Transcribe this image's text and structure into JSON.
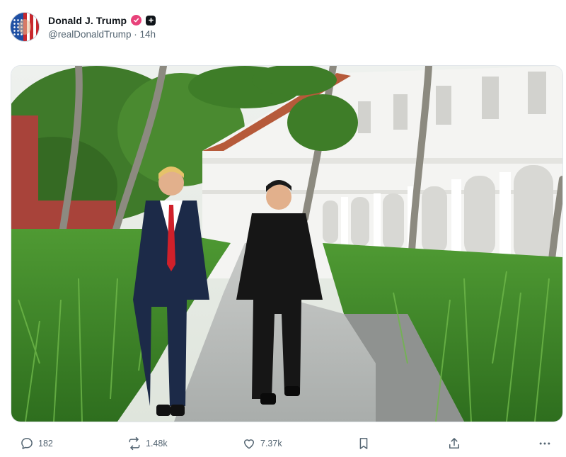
{
  "post": {
    "author": {
      "display_name": "Donald J. Trump",
      "handle": "@realDonaldTrump",
      "time_ago": "14h",
      "separator": "·",
      "verified_badge_color": "#e8427a"
    },
    "media": {
      "description_icon": "photo",
      "scene": "outdoor-garden-walkway"
    },
    "actions": {
      "replies": "182",
      "reposts": "1.48k",
      "likes": "7.37k"
    }
  },
  "colors": {
    "text_primary": "#0f1419",
    "text_secondary": "#536471",
    "background": "#ffffff"
  },
  "icons": {
    "reply": "speech-bubble-icon",
    "repost": "repost-arrows-icon",
    "like": "heart-icon",
    "bookmark": "bookmark-icon",
    "share": "upload-icon",
    "more": "ellipsis-icon"
  }
}
